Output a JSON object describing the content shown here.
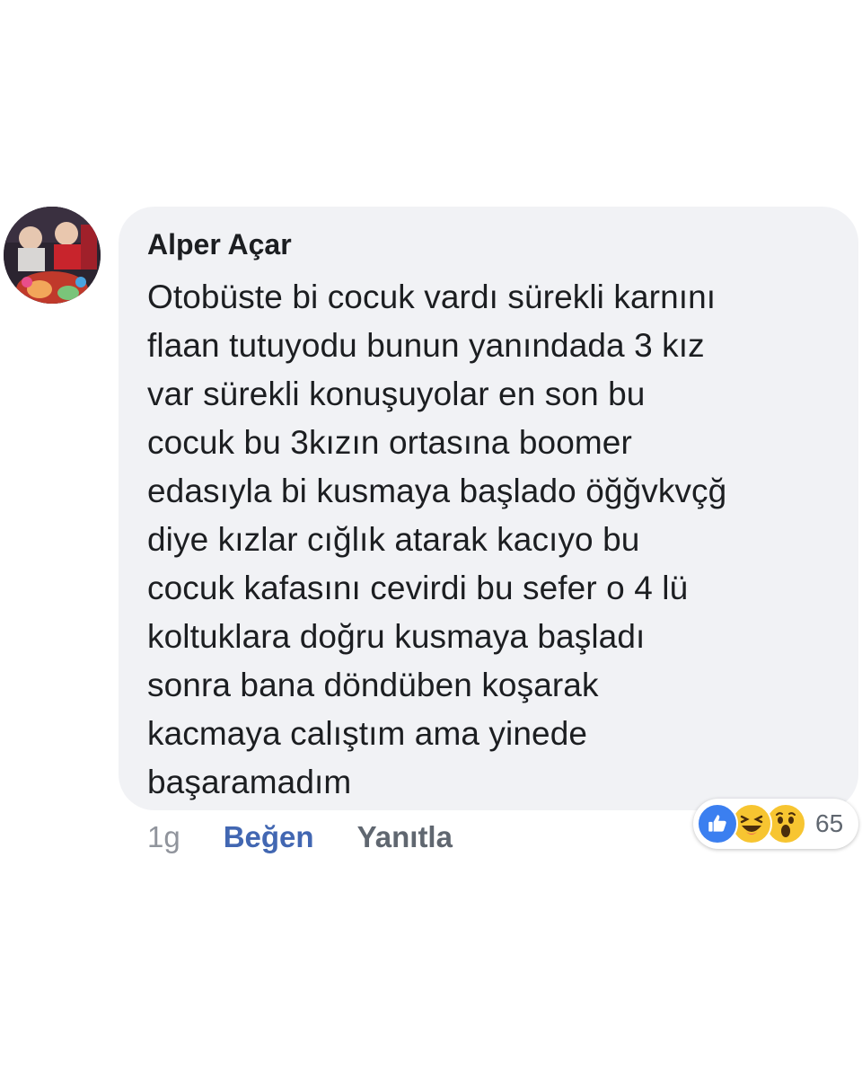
{
  "comment": {
    "author": "Alper Açar",
    "text": "Otobüste bi cocuk vardı sürekli karnını\nflaan tutuyodu bunun yanındada 3 kız\nvar sürekli konuşuyolar en son bu\ncocuk bu 3kızın ortasına boomer\nedasıyla bi kusmaya başlado öğğvkvçğ\ndiye kızlar cığlık atarak kacıyo bu\ncocuk kafasını cevirdi bu sefer o 4 lü\nkoltuklara doğru kusmaya başladı\nsonra bana döndüben koşarak\nkacmaya calıştım ama yinede\nbaşaramadım"
  },
  "actions": {
    "time": "1g",
    "like_label": "Beğen",
    "reply_label": "Yanıtla"
  },
  "reactions": {
    "icons": [
      "like-icon",
      "haha-icon",
      "wow-icon"
    ],
    "count": "65"
  },
  "colors": {
    "bubble_bg": "#f1f2f5",
    "like_blue": "#4267b2",
    "muted_gray": "#90949c",
    "reaction_yellow": "#f7c531"
  }
}
